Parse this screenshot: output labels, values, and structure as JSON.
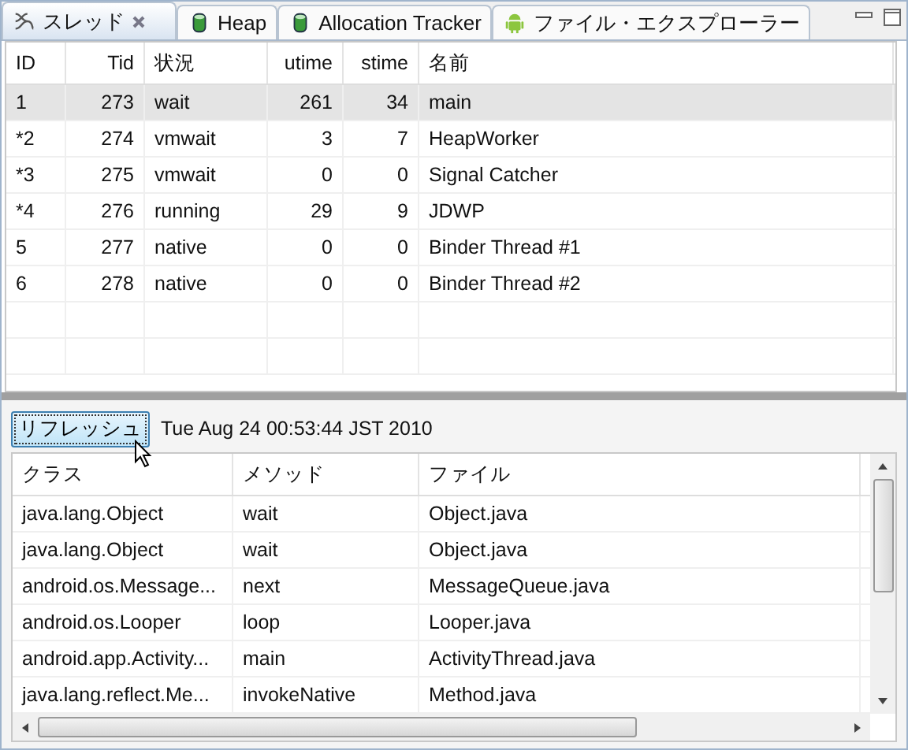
{
  "tabs": [
    {
      "label": "スレッド",
      "kind": "threads",
      "closable": true,
      "selected": true
    },
    {
      "label": "Heap",
      "kind": "cylinder",
      "closable": false,
      "selected": false
    },
    {
      "label": "Allocation Tracker",
      "kind": "cylinder",
      "closable": false,
      "selected": false
    },
    {
      "label": "ファイル・エクスプローラー",
      "kind": "android",
      "closable": false,
      "selected": false
    }
  ],
  "threads": {
    "columns": [
      "ID",
      "Tid",
      "状況",
      "utime",
      "stime",
      "名前"
    ],
    "rows": [
      {
        "cells": [
          "1",
          "273",
          "wait",
          "261",
          "34",
          "main"
        ],
        "selected": true
      },
      {
        "cells": [
          "*2",
          "274",
          "vmwait",
          "3",
          "7",
          "HeapWorker"
        ],
        "selected": false
      },
      {
        "cells": [
          "*3",
          "275",
          "vmwait",
          "0",
          "0",
          "Signal Catcher"
        ],
        "selected": false
      },
      {
        "cells": [
          "*4",
          "276",
          "running",
          "29",
          "9",
          "JDWP"
        ],
        "selected": false
      },
      {
        "cells": [
          "5",
          "277",
          "native",
          "0",
          "0",
          "Binder Thread #1"
        ],
        "selected": false
      },
      {
        "cells": [
          "6",
          "278",
          "native",
          "0",
          "0",
          "Binder Thread #2"
        ],
        "selected": false
      }
    ]
  },
  "refresh_button": "リフレッシュ",
  "timestamp": "Tue Aug 24 00:53:44 JST 2010",
  "stack": {
    "columns": [
      "クラス",
      "メソッド",
      "ファイル"
    ],
    "rows": [
      [
        "java.lang.Object",
        "wait",
        "Object.java"
      ],
      [
        "java.lang.Object",
        "wait",
        "Object.java"
      ],
      [
        "android.os.Message...",
        "next",
        "MessageQueue.java"
      ],
      [
        "android.os.Looper",
        "loop",
        "Looper.java"
      ],
      [
        "android.app.Activity...",
        "main",
        "ActivityThread.java"
      ],
      [
        "java.lang.reflect.Me...",
        "invokeNative",
        "Method.java"
      ]
    ]
  }
}
